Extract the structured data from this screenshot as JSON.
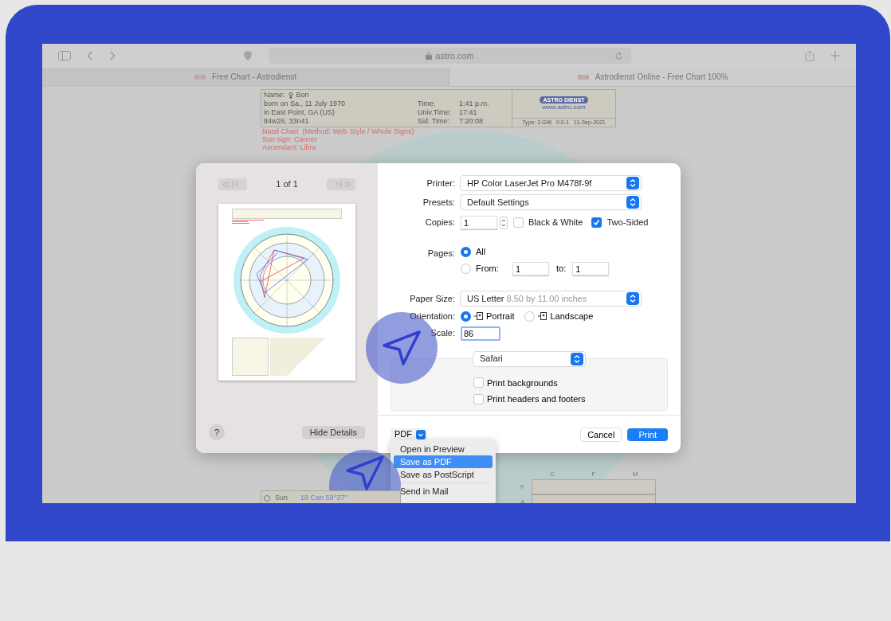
{
  "browser": {
    "url": "astro.com",
    "tabs": [
      {
        "label": "Free Chart - Astrodienst",
        "selected": true
      },
      {
        "label": "Astrodienst Online - Free Chart 100%",
        "selected": false
      }
    ]
  },
  "chart_header": {
    "name_label": "Name:",
    "name": "Bon",
    "lines": [
      "born on Sa., 11 July 1970",
      "in East Point, GA (US)",
      "84w26, 33n41"
    ],
    "times": [
      {
        "label": "Time:",
        "value": "1:41 p.m."
      },
      {
        "label": "Univ.Time:",
        "value": "17:41"
      },
      {
        "label": "Sid. Time:",
        "value": "7:20:08"
      }
    ],
    "logo": {
      "left": "ASTRO",
      "right": "DIENST",
      "url": "www.astro.com"
    },
    "type": "Type: 2.GW   0.0-1   11-Sep-2021",
    "notes": [
      "Natal Chart  (Method: Web Style / Whole Signs)",
      "Sun sign: Cancer",
      "Ascendant: Libra"
    ]
  },
  "print_dialog": {
    "preview": {
      "page_indicator": "1 of 1",
      "help": "?",
      "hide_details": "Hide Details"
    },
    "printer": {
      "label": "Printer:",
      "value": "HP Color LaserJet Pro M478f-9f"
    },
    "presets": {
      "label": "Presets:",
      "value": "Default Settings"
    },
    "copies": {
      "label": "Copies:",
      "value": "1"
    },
    "copy_options": [
      {
        "label": "Black & White",
        "checked": false
      },
      {
        "label": "Two-Sided",
        "checked": true
      }
    ],
    "pages": {
      "label": "Pages:",
      "options": [
        {
          "label": "All",
          "selected": true
        },
        {
          "label": "From:",
          "selected": false
        }
      ],
      "from": "1",
      "to_label": "to:",
      "to": "1"
    },
    "paper_size": {
      "label": "Paper Size:",
      "value": "US Letter",
      "detail": "8.50 by 11.00 inches"
    },
    "orientation": {
      "label": "Orientation:",
      "options": [
        {
          "label": "Portrait",
          "selected": true
        },
        {
          "label": "Landscape",
          "selected": false
        }
      ]
    },
    "scale": {
      "label": "Scale:",
      "value": "86"
    },
    "app_section": {
      "value": "Safari",
      "options": [
        {
          "label": "Print backgrounds",
          "checked": false
        },
        {
          "label": "Print headers and footers",
          "checked": false
        }
      ]
    },
    "pdf_button": "PDF",
    "cancel": "Cancel",
    "print": "Print",
    "pdf_menu": [
      {
        "label": "Open in Preview",
        "selected": false
      },
      {
        "label": "Save as PDF",
        "selected": true
      },
      {
        "label": "Save as PostScript",
        "selected": false
      },
      {
        "label": "Send in Mail",
        "selected": false
      }
    ]
  },
  "page_bottom": {
    "planet": "Sun",
    "position": "18 Can 59°37\"",
    "grid_columns": [
      "C",
      "F",
      "M"
    ],
    "grid_rows": [
      "F",
      "A"
    ]
  }
}
